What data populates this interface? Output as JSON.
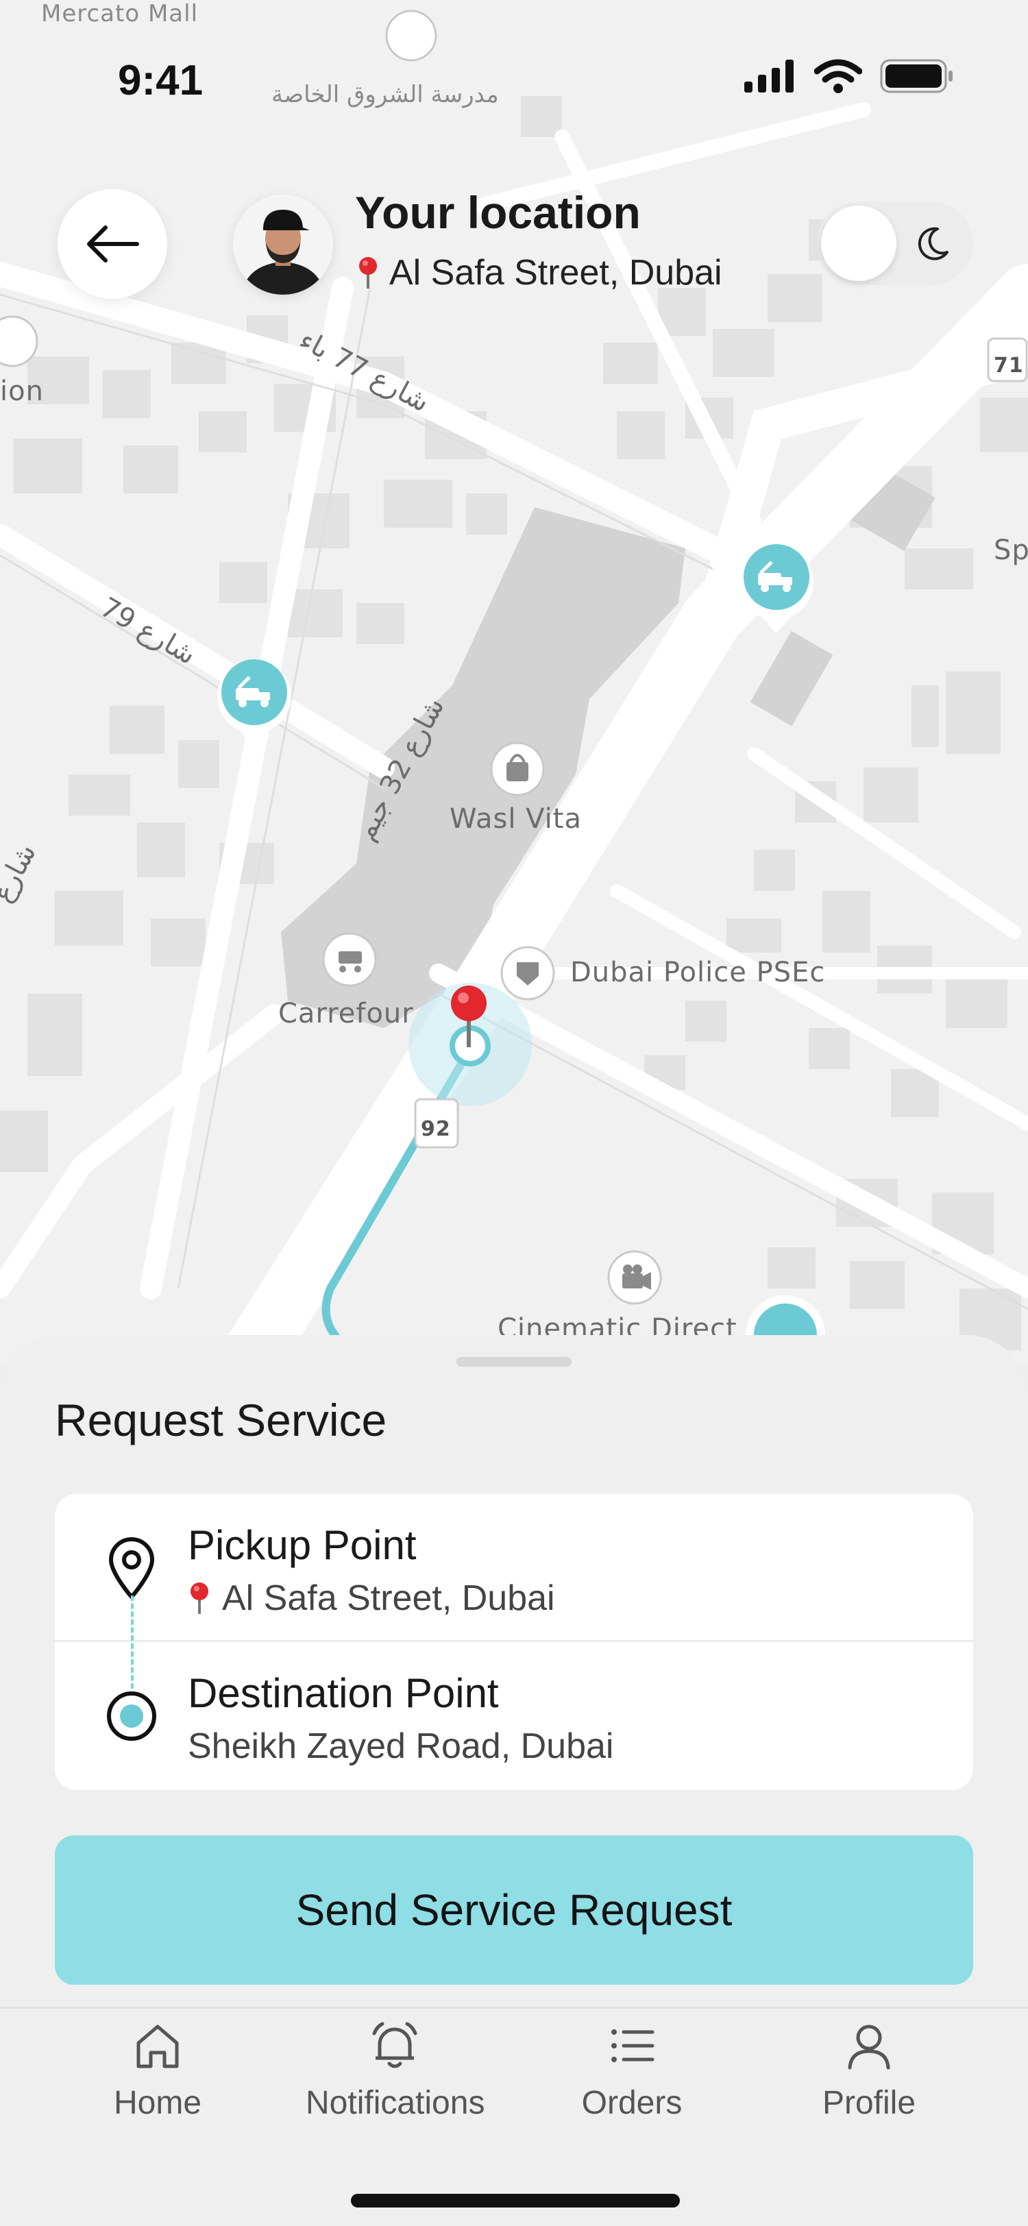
{
  "status_bar": {
    "time": "9:41"
  },
  "header": {
    "title": "Your location",
    "address": "Al Safa Street, Dubai"
  },
  "map": {
    "labels": {
      "mall": "Mercato Mall",
      "school": "مدرسة الشروق الخاصة",
      "street_77": "شارع 77 باء",
      "street_79": "شارع 79",
      "street_32": "شارع 32 جيم",
      "street_edge": "شارع",
      "edge_on": "ion",
      "shop": "Wasl Vita",
      "supermarket": "Carrefour",
      "police": "Dubai Police PSEc",
      "cinema": "Cinematic Direct",
      "road_71": "71",
      "road_92": "92",
      "edge_sp": "Sp"
    }
  },
  "sheet": {
    "title": "Request Service",
    "pickup": {
      "label": "Pickup Point",
      "value": "Al Safa Street, Dubai"
    },
    "destination": {
      "label": "Destination Point",
      "value": "Sheikh Zayed Road, Dubai"
    },
    "cta_label": "Send Service Request"
  },
  "tabs": [
    {
      "label": "Home",
      "icon": "home-icon"
    },
    {
      "label": "Notifications",
      "icon": "bell-icon"
    },
    {
      "label": "Orders",
      "icon": "list-icon"
    },
    {
      "label": "Profile",
      "icon": "user-icon"
    }
  ],
  "colors": {
    "accent": "#8fdde5",
    "marker": "#6ccad4",
    "pin": "#e0282e"
  }
}
